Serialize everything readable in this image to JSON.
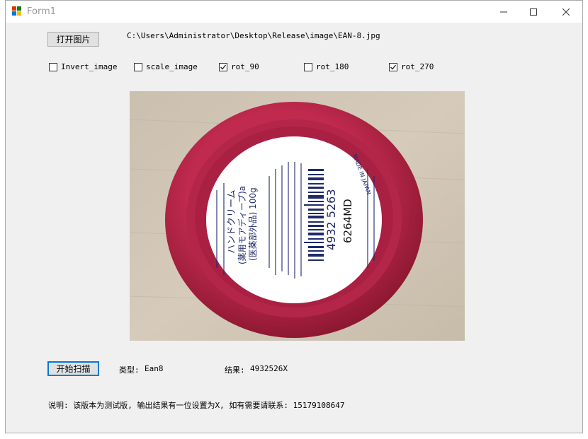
{
  "window": {
    "title": "Form1",
    "controls": {
      "minimize": "minimize-icon",
      "maximize": "maximize-icon",
      "close": "close-icon"
    }
  },
  "toolbar": {
    "open_button": "打开图片",
    "file_path": "C:\\Users\\Administrator\\Desktop\\Release\\image\\EAN-8.jpg"
  },
  "options": [
    {
      "label": "Invert_image",
      "checked": false
    },
    {
      "label": "scale_image",
      "checked": false
    },
    {
      "label": "rot_90",
      "checked": true
    },
    {
      "label": "rot_180",
      "checked": false
    },
    {
      "label": "rot_270",
      "checked": true
    }
  ],
  "image": {
    "jar_name": "ハンドクリーム",
    "jar_line2": "(薬用モアディープ)a",
    "jar_line3": "(医薬部外品) 100g",
    "barcode_number": "4932 5263",
    "product_code": "6264MD",
    "made_in": "MADE IN JAPAN"
  },
  "scan": {
    "start_button": "开始扫描",
    "type_label": "类型:",
    "type_value": "Ean8",
    "result_label": "结果:",
    "result_value": "4932526X"
  },
  "note": "说明: 该版本为测试版, 输出结果有一位设置为X, 如有需要请联系: 15179108647",
  "colors": {
    "accent": "#0078d7",
    "form_bg": "#f0f0f0",
    "jar_red": "#b5274a"
  }
}
